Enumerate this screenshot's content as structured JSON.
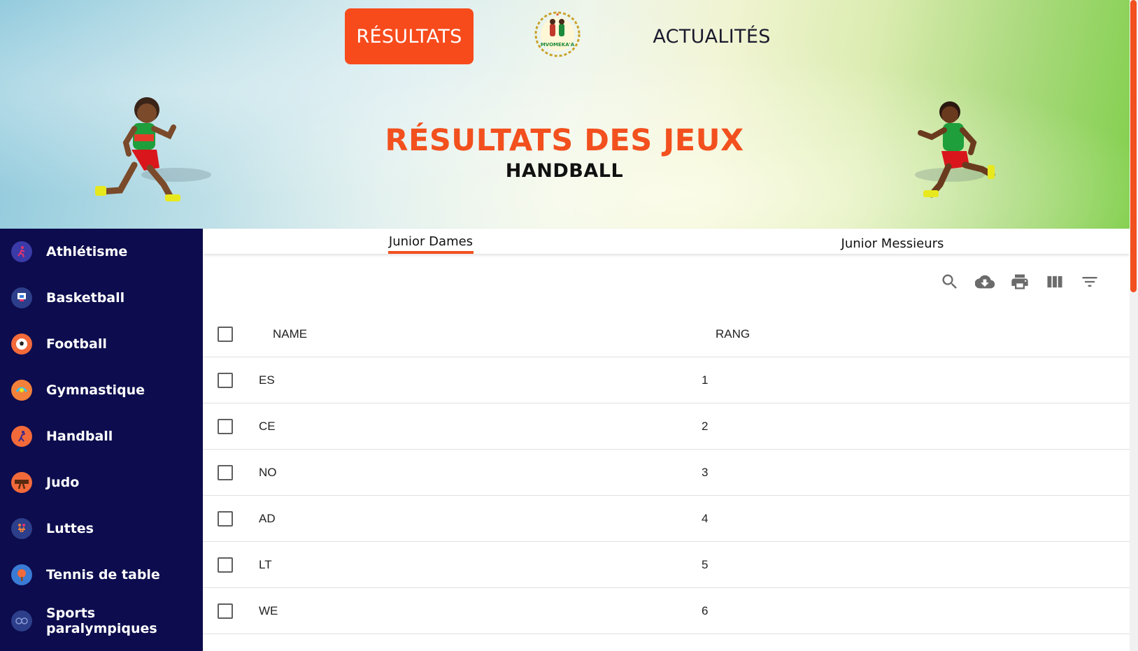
{
  "nav": {
    "results_label": "RÉSULTATS",
    "news_label": "ACTUALITÉS",
    "logo_text": "MVOMEKA'A"
  },
  "hero": {
    "title": "RÉSULTATS DES JEUX",
    "subtitle": "HANDBALL"
  },
  "colors": {
    "accent": "#f2501e",
    "sidebar_bg": "#0c0c4e"
  },
  "sidebar": {
    "items": [
      {
        "label": "Athlétisme",
        "icon": "running-icon"
      },
      {
        "label": "Basketball",
        "icon": "basketball-icon"
      },
      {
        "label": "Football",
        "icon": "football-icon"
      },
      {
        "label": "Gymnastique",
        "icon": "gymnastics-icon"
      },
      {
        "label": "Handball",
        "icon": "handball-icon"
      },
      {
        "label": "Judo",
        "icon": "judo-icon"
      },
      {
        "label": "Luttes",
        "icon": "wrestling-icon"
      },
      {
        "label": "Tennis de table",
        "icon": "table-tennis-icon"
      },
      {
        "label": "Sports paralympiques",
        "icon": "paralympic-icon"
      }
    ]
  },
  "tabs": [
    {
      "label": "Junior Dames",
      "active": true
    },
    {
      "label": "Junior Messieurs",
      "active": false
    }
  ],
  "toolbar": {
    "icons": [
      "search-icon",
      "download-icon",
      "print-icon",
      "view-columns-icon",
      "filter-icon"
    ]
  },
  "table": {
    "columns": [
      "NAME",
      "RANG"
    ],
    "rows": [
      {
        "name": "ES",
        "rang": "1"
      },
      {
        "name": "CE",
        "rang": "2"
      },
      {
        "name": "NO",
        "rang": "3"
      },
      {
        "name": "AD",
        "rang": "4"
      },
      {
        "name": "LT",
        "rang": "5"
      },
      {
        "name": "WE",
        "rang": "6"
      }
    ]
  }
}
